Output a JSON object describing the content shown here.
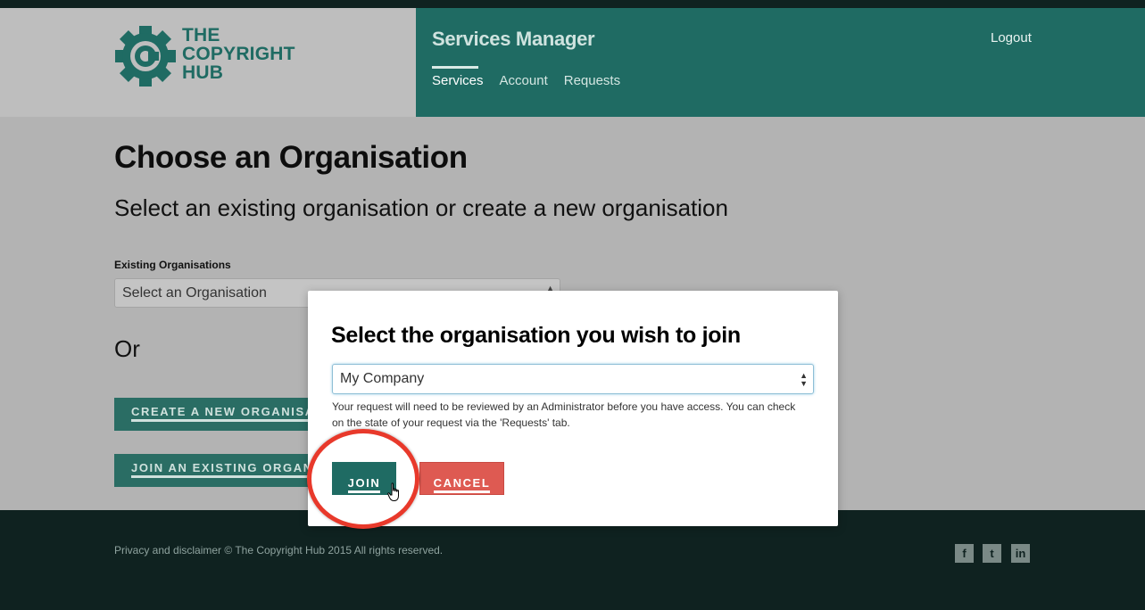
{
  "header": {
    "logo_lines": [
      "THE",
      "COPYRIGHT",
      "HUB"
    ],
    "app_title": "Services Manager",
    "logout_label": "Logout",
    "nav": [
      {
        "label": "Services",
        "active": true
      },
      {
        "label": "Account",
        "active": false
      },
      {
        "label": "Requests",
        "active": false
      }
    ]
  },
  "main": {
    "title": "Choose an Organisation",
    "subtitle": "Select an existing organisation or create a new organisation",
    "existing_label": "Existing Organisations",
    "existing_select_value": "Select an Organisation",
    "or_text": "Or",
    "create_button": "CREATE A NEW ORGANISATION",
    "join_existing_button": "JOIN AN EXISTING ORGANISATION"
  },
  "modal": {
    "title": "Select the organisation you wish to join",
    "select_value": "My Company",
    "help_text": "Your request will need to be reviewed by an Administrator before you have access. You can check on the state of your request via the 'Requests' tab.",
    "join_label": "JOIN",
    "cancel_label": "CANCEL"
  },
  "footer": {
    "text": "Privacy and disclaimer © The Copyright Hub 2015 All rights reserved.",
    "social": [
      {
        "icon": "facebook-icon",
        "glyph": "f"
      },
      {
        "icon": "twitter-icon",
        "glyph": "t"
      },
      {
        "icon": "linkedin-icon",
        "glyph": "in"
      }
    ]
  },
  "colors": {
    "brand_teal": "#1f6b63",
    "cancel_red": "#de5a52",
    "highlight_red": "#e8392b",
    "footer_dark": "#0f2220"
  }
}
